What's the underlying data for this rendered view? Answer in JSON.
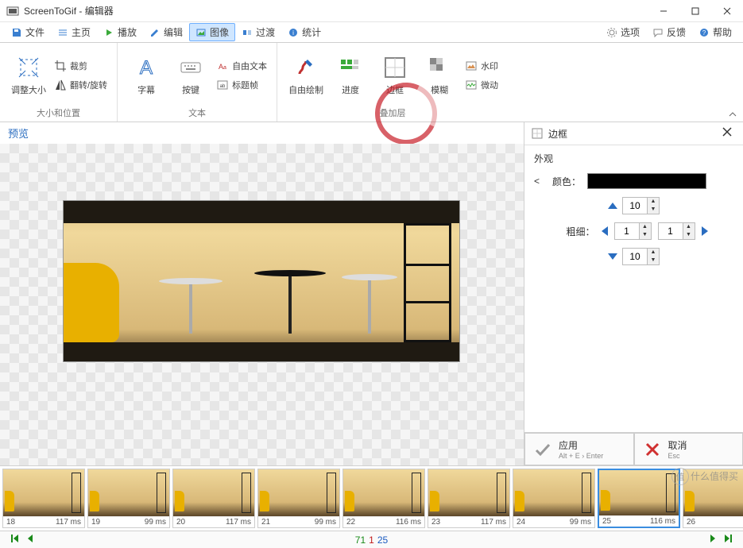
{
  "window": {
    "title": "ScreenToGif - 编辑器"
  },
  "menu": {
    "file": "文件",
    "home": "主页",
    "play": "播放",
    "edit": "编辑",
    "image": "图像",
    "transition": "过渡",
    "stats": "统计",
    "options": "选项",
    "feedback": "反馈",
    "help": "帮助"
  },
  "ribbon": {
    "group_size": "大小和位置",
    "group_text": "文本",
    "group_overlay": "叠加层",
    "resize": "调整大小",
    "crop": "裁剪",
    "fliprotate": "翻转/旋转",
    "caption": "字幕",
    "keys": "按键",
    "freetext": "自由文本",
    "titleframe": "标题帧",
    "freedraw": "自由绘制",
    "progress": "进度",
    "border": "边框",
    "blur": "模糊",
    "watermark": "水印",
    "cinemagraph": "微动"
  },
  "preview": {
    "header": "预览"
  },
  "panel": {
    "title": "边框",
    "section": "外观",
    "color_label": "颜色：",
    "thickness_label": "粗细：",
    "top_val": "10",
    "left_val": "1",
    "right_val": "1",
    "bottom_val": "10",
    "apply": "应用",
    "apply_hint": "Alt + E › Enter",
    "cancel": "取消",
    "cancel_hint": "Esc"
  },
  "frames": [
    {
      "idx": "18",
      "ms": "117 ms"
    },
    {
      "idx": "19",
      "ms": "99 ms"
    },
    {
      "idx": "20",
      "ms": "117 ms"
    },
    {
      "idx": "21",
      "ms": "99 ms"
    },
    {
      "idx": "22",
      "ms": "116 ms"
    },
    {
      "idx": "23",
      "ms": "117 ms"
    },
    {
      "idx": "24",
      "ms": "99 ms"
    },
    {
      "idx": "25",
      "ms": "116 ms",
      "selected": true
    },
    {
      "idx": "26",
      "ms": ""
    }
  ],
  "status": {
    "total": "71",
    "selected": "1",
    "current": "25"
  },
  "watermark_text": "什么值得买"
}
